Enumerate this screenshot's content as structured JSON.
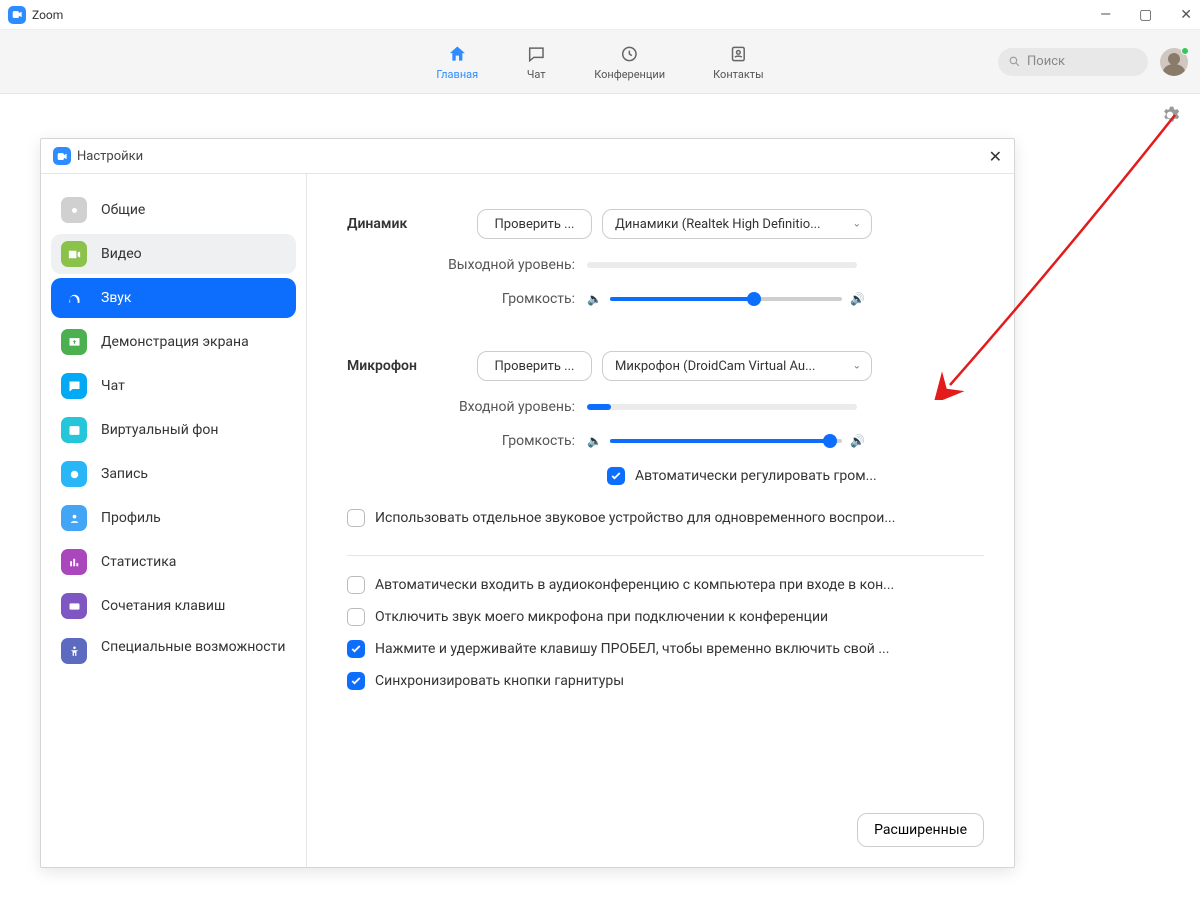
{
  "titlebar": {
    "app_name": "Zoom"
  },
  "nav": {
    "tabs": [
      {
        "label": "Главная"
      },
      {
        "label": "Чат"
      },
      {
        "label": "Конференции"
      },
      {
        "label": "Контакты"
      }
    ],
    "search_placeholder": "Поиск"
  },
  "modal": {
    "title": "Настройки",
    "sidebar": [
      {
        "label": "Общие"
      },
      {
        "label": "Видео"
      },
      {
        "label": "Звук"
      },
      {
        "label": "Демонстрация экрана"
      },
      {
        "label": "Чат"
      },
      {
        "label": "Виртуальный фон"
      },
      {
        "label": "Запись"
      },
      {
        "label": "Профиль"
      },
      {
        "label": "Статистика"
      },
      {
        "label": "Сочетания клавиш"
      },
      {
        "label": "Специальные возможности"
      }
    ],
    "audio": {
      "speaker_label": "Динамик",
      "speaker_test": "Проверить ...",
      "speaker_device": "Динамики (Realtek High Definitio...",
      "output_level_label": "Выходной уровень:",
      "output_level_pct": 0,
      "speaker_vol_label": "Громкость:",
      "speaker_vol_pct": 62,
      "mic_label": "Микрофон",
      "mic_test": "Проверить ...",
      "mic_device": "Микрофон (DroidCam Virtual Au...",
      "input_level_label": "Входной уровень:",
      "input_level_pct": 9,
      "mic_vol_label": "Громкость:",
      "mic_vol_pct": 95,
      "auto_adjust": "Автоматически регулировать гром...",
      "opt_separate": "Использовать отдельное звуковое устройство для одновременного воспрои...",
      "opt_auto_join": "Автоматически входить в аудиоконференцию с компьютера при входе в кон...",
      "opt_mute_on_join": "Отключить звук моего микрофона при подключении к конференции",
      "opt_space_unmute": "Нажмите и удерживайте клавишу ПРОБЕЛ, чтобы временно включить свой ...",
      "opt_sync_headset": "Синхронизировать кнопки гарнитуры",
      "advanced_btn": "Расширенные"
    }
  },
  "icon_colors": {
    "general": "#d0d0d0",
    "video": "#8bc34a",
    "audio": "#0d6efd",
    "share": "#4caf50",
    "chat": "#03a9f4",
    "vbg": "#26c6da",
    "record": "#29b6f6",
    "profile": "#42a5f5",
    "stats": "#ab47bc",
    "shortcuts": "#7e57c2",
    "a11y": "#5c6bc0"
  }
}
